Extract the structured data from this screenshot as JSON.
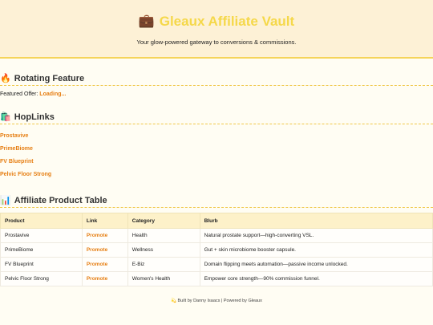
{
  "header": {
    "title": "Gleaux Affiliate Vault",
    "tagline": "Your glow-powered gateway to conversions & commissions."
  },
  "rotating": {
    "heading": "Rotating Feature",
    "label": "Featured Offer:",
    "value": "Loading..."
  },
  "hoplinks": {
    "heading": "HopLinks",
    "items": [
      "Prostavive",
      "PrimeBiome",
      "FV Blueprint",
      "Pelvic Floor Strong"
    ]
  },
  "table": {
    "heading": "Affiliate Product Table",
    "columns": [
      "Product",
      "Link",
      "Category",
      "Blurb"
    ],
    "rows": [
      [
        "Prostavive",
        "Promote",
        "Health",
        "Natural prostate support—high-converting VSL."
      ],
      [
        "PrimeBiome",
        "Promote",
        "Wellness",
        "Gut + skin microbiome booster capsule."
      ],
      [
        "FV Blueprint",
        "Promote",
        "E-Biz",
        "Domain flipping meets automation—passive income unlocked."
      ],
      [
        "Pelvic Floor Strong",
        "Promote",
        "Women's Health",
        "Empower core strength—90% commission funnel."
      ]
    ]
  },
  "footer": {
    "icon": "💫",
    "text": "Built by Danny Isaacs | Powered by Gleaux"
  },
  "colors": {
    "accent": "#e67e12",
    "title_gold": "#f5d84a",
    "header_bg": "#fdf1d6"
  }
}
